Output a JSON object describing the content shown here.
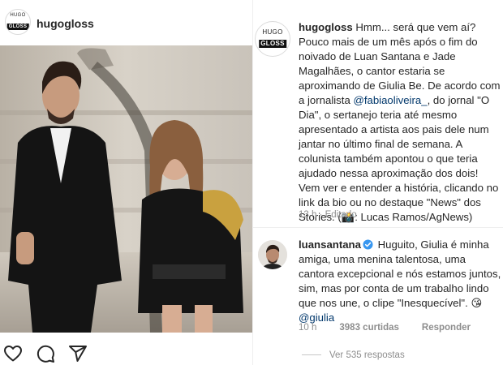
{
  "post": {
    "username": "hugogloss",
    "avatar_logo": {
      "line1": "HUGO",
      "line2": "GLOSS"
    },
    "photo_alt_icon": "photo"
  },
  "caption": {
    "username": "hugogloss",
    "text_before_mention": " Hmm... será que vem aí? Pouco mais de um mês após o fim do noivado de Luan Santana e Jade Magalhães, o cantor estaria se aproximando de Giulia Be. De acordo com a jornalista ",
    "mention": "@fabiaoliveira_",
    "text_after_mention": ", do jornal \"O Dia\", o sertanejo teria até mesmo apresentado a artista aos pais dele num jantar no último final de semana. A colunista também apontou o que teria ajudado nessa aproximação dos dois! Vem ver e entender a história, clicando no link da bio ou no destaque \"News\" dos Stories. (",
    "emoji": "📸",
    "text_end": ": Lucas Ramos/AgNews)",
    "meta": "13 h · Editado"
  },
  "comment": {
    "username": "luansantana",
    "text_before_mention": " Huguito, Giulia é minha amiga, uma menina talentosa, uma cantora excepcional e nós estamos juntos, sim, mas por conta de um trabalho lindo que nos une, o clipe \"Inesquecível\". ",
    "emoji": "😘",
    "mention": "@giulia",
    "time": "10 h",
    "likes": "3983 curtidas",
    "reply": "Responder",
    "view_replies": "Ver 535 respostas"
  },
  "colors": {
    "text": "#262626",
    "secondary": "#8e8e8e",
    "link": "#00376b",
    "verified": "#3897f0"
  },
  "icons": {
    "like": "heart-icon",
    "comment": "comment-icon",
    "share": "share-icon",
    "verified": "verified-badge-icon",
    "camera": "camera-emoji"
  }
}
